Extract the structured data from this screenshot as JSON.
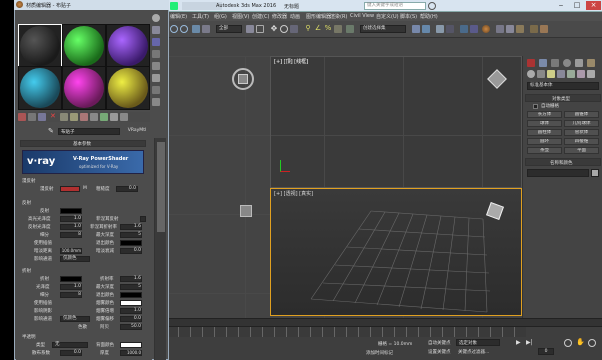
{
  "main_window": {
    "title": "Autodesk 3ds Max 2016",
    "doc_title": "无标题",
    "search_placeholder": "键入关键字或短语",
    "menu_items": [
      "编辑(E)",
      "工具(T)",
      "组(G)",
      "视图(V)",
      "创建(C)",
      "修改器",
      "动画",
      "图形编辑器",
      "渲染(R)",
      "Civil View",
      "自定义(U)",
      "脚本(S)",
      "帮助(H)"
    ],
    "toolbar_dropdown": "全部",
    "selection_set": "创建选择集"
  },
  "viewports": {
    "top_label": "[+] [顶] [线框]",
    "persp_label": "[+] [透视] [真实]"
  },
  "material_editor": {
    "title": "材质编辑器 - 布贴子",
    "material_name": "布贴子",
    "material_type": "VRayMtl",
    "rollout_basic": "基本参数",
    "vray_brand": "V-Ray PowerShader",
    "vray_sub": "optimized for V-Ray",
    "section_diffuse": "漫反射",
    "diffuse_label": "漫反射",
    "diffuse_m": "M",
    "roughness_label": "粗糙度",
    "roughness_value": "0.0",
    "section_reflect": "反射",
    "reflect_label": "反射",
    "hilight_gloss": "高光光泽度",
    "hilight_val": "1.0",
    "refl_gloss": "反射光泽度",
    "refl_val": "1.0",
    "subdivs": "细分",
    "subdivs_val": "8",
    "use_interp": "使用插值",
    "dim_distance": "暗淡距离",
    "dim_val": "100.0mm",
    "affect_channels": "影响通道",
    "channels_val": "仅颜色",
    "fresnel": "菲涅耳反射",
    "fresnel_ior": "菲涅耳折射率",
    "fresnel_ior_val": "1.6",
    "max_depth": "最大深度",
    "max_depth_val": "5",
    "exit_color": "退出颜色",
    "dim_falloff": "暗淡衰减",
    "dim_falloff_val": "0.0",
    "section_refract": "折射",
    "refract_label": "折射",
    "ior": "折射率",
    "ior_val": "1.6",
    "gloss": "光泽度",
    "gloss_val": "1.0",
    "max_depth2_val": "5",
    "subdivs2_val": "8",
    "exit_color2": "退出颜色",
    "use_interp2": "使用插值",
    "fog_color": "烟雾颜色",
    "affect_shadows": "影响阴影",
    "fog_mult": "烟雾倍增",
    "fog_mult_val": "1.0",
    "affect_ch2": "影响通道",
    "ch2_val": "仅颜色",
    "fog_bias": "烟雾偏移",
    "fog_bias_val": "0.0",
    "dispersion": "色散",
    "abbe": "阿贝",
    "abbe_val": "50.0",
    "section_trans": "半透明",
    "type_label": "类型",
    "type_val": "无",
    "back_color": "背面颜色",
    "thickness": "厚度",
    "thickness_val": "1000.0",
    "scatter": "散布系数",
    "scatter_val": "0.0"
  },
  "command_panel": {
    "category": "标准基本体",
    "rollout_type": "对象类型",
    "auto_grid": "自动栅格",
    "objects": [
      "长方体",
      "圆锥体",
      "球体",
      "几何球体",
      "圆柱体",
      "管状体",
      "圆环",
      "四棱锥",
      "茶壶",
      "平面"
    ],
    "rollout_name": "名称和颜色"
  },
  "status_bar": {
    "grid": "栅格 = 10.0mm",
    "add_time_tag": "添加时间标记",
    "set_key_filter": "设置关键点",
    "auto_key": "自动关键点",
    "selected": "选定对象",
    "key_filters": "关键点过滤器...",
    "frame": "0"
  },
  "colors": {
    "diffuse_swatch": "#b03030",
    "vray_banner": "#2a5a9a",
    "selected_slot_border": "#ffffff",
    "persp_border": "#e0a020"
  }
}
